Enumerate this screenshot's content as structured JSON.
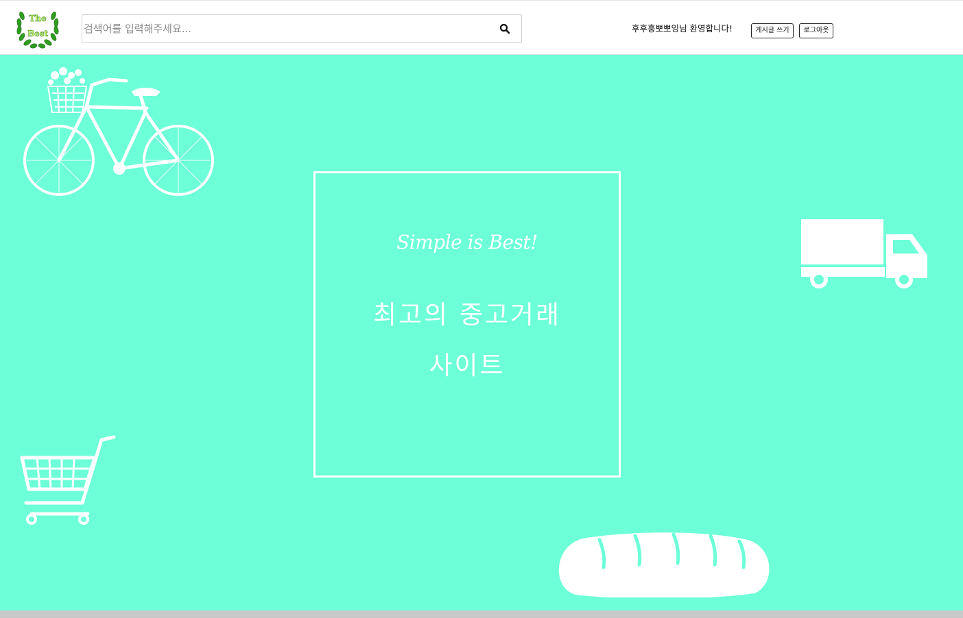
{
  "header": {
    "logo_text_top": "The",
    "logo_text_bottom": "Best",
    "search": {
      "placeholder": "검색어를 입력해주세요..."
    },
    "welcome": "후후훙뽀뽀잉님 환영합니다!",
    "write_button": "게시글 쓰기",
    "logout_button": "로그아웃"
  },
  "hero": {
    "slogan": "Simple is Best!",
    "title_line1": "최고의 중고거래",
    "title_line2": "사이트",
    "background_color": "#6cffd8"
  },
  "icons": [
    "bicycle-icon",
    "truck-icon",
    "shopping-cart-icon",
    "bread-icon",
    "search-icon",
    "laurel-logo-icon"
  ]
}
